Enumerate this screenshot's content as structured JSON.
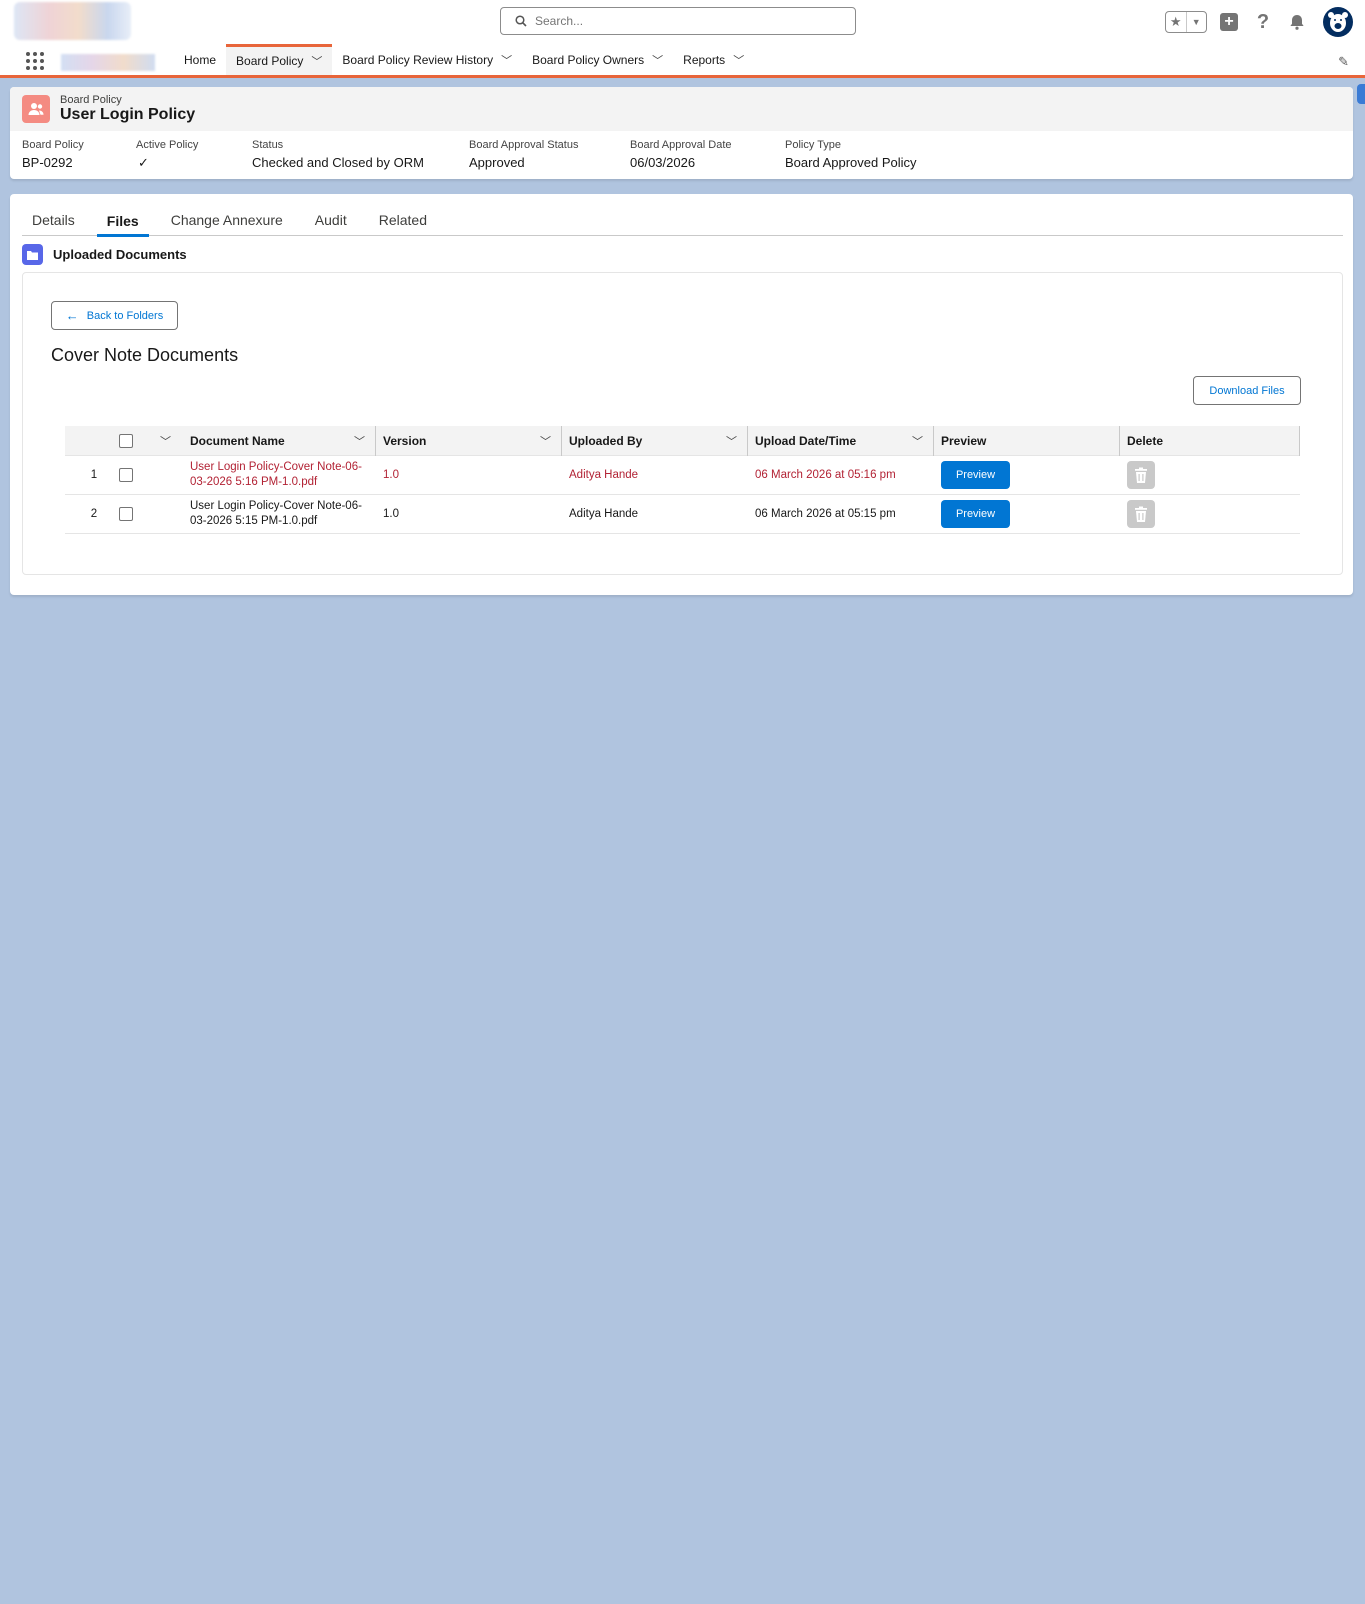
{
  "header": {
    "search_placeholder": "Search..."
  },
  "nav": {
    "items": [
      {
        "label": "Home",
        "has_menu": false
      },
      {
        "label": "Board Policy",
        "has_menu": true,
        "active": true
      },
      {
        "label": "Board Policy Review History",
        "has_menu": true
      },
      {
        "label": "Board Policy Owners",
        "has_menu": true
      },
      {
        "label": "Reports",
        "has_menu": true
      }
    ]
  },
  "record": {
    "object_type": "Board Policy",
    "title": "User Login Policy",
    "fields": [
      {
        "label": "Board Policy",
        "value": "BP-0292"
      },
      {
        "label": "Active Policy",
        "value": "✓"
      },
      {
        "label": "Status",
        "value": "Checked and Closed by ORM"
      },
      {
        "label": "Board Approval Status",
        "value": "Approved"
      },
      {
        "label": "Board Approval Date",
        "value": "06/03/2026"
      },
      {
        "label": "Policy Type",
        "value": "Board Approved Policy"
      }
    ]
  },
  "tabs": [
    "Details",
    "Files",
    "Change Annexure",
    "Audit",
    "Related"
  ],
  "active_tab": "Files",
  "section": {
    "title": "Uploaded Documents",
    "back_label": "Back to Folders",
    "folder_name": "Cover Note Documents",
    "download_label": "Download Files"
  },
  "table": {
    "columns": [
      "Document Name",
      "Version",
      "Uploaded By",
      "Upload Date/Time",
      "Preview",
      "Delete"
    ],
    "rows": [
      {
        "num": "1",
        "name_line1": "User Login Policy-Cover Note-06-",
        "name_line2": "03-2026 5:16 PM-1.0.pdf",
        "version": "1.0",
        "uploaded_by": "Aditya Hande",
        "datetime": "06 March 2026 at 05:16 pm",
        "preview_label": "Preview",
        "highlight": true
      },
      {
        "num": "2",
        "name_line1": "User Login Policy-Cover Note-06-",
        "name_line2": "03-2026 5:15 PM-1.0.pdf",
        "version": "1.0",
        "uploaded_by": "Aditya Hande",
        "datetime": "06 March 2026 at 05:15 pm",
        "preview_label": "Preview",
        "highlight": false
      }
    ]
  },
  "colors": {
    "brand_blue": "#0176d3",
    "nav_accent": "#e8653a",
    "record_icon": "#f48b82",
    "folder_icon": "#5867e8",
    "highlight_text": "#b22234",
    "page_background": "#b0c4df"
  }
}
